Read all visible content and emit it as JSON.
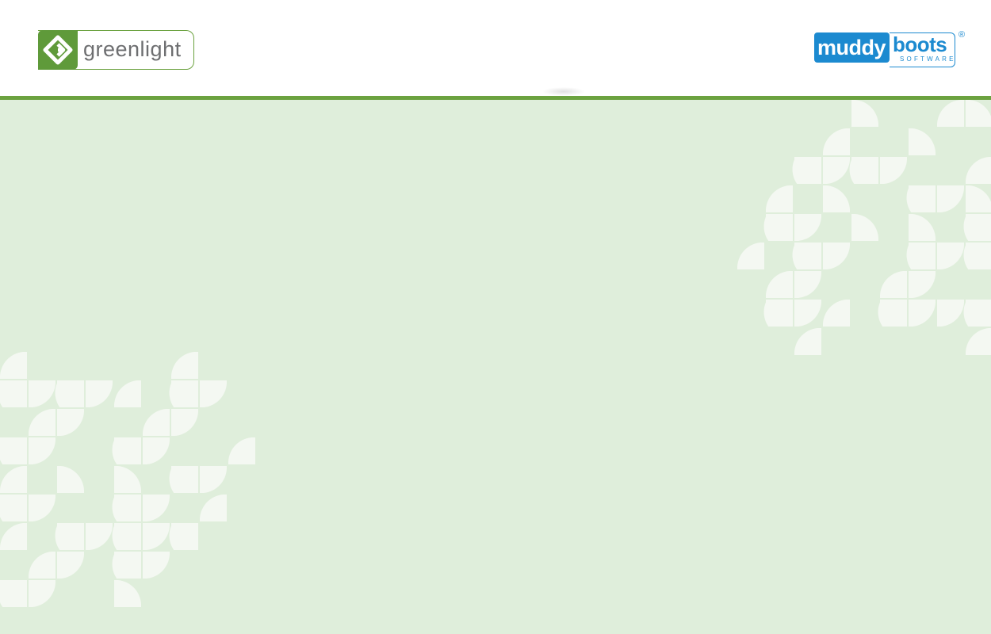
{
  "header": {
    "left_logo": {
      "text": "greenlight",
      "icon": "greenlight-g-icon",
      "color": "#5f9a3a"
    },
    "right_logo": {
      "word1": "muddy",
      "word2": "boots",
      "tagline": "SOFTWARE",
      "registered": "®",
      "color": "#1c8ad0"
    },
    "rule_color": "#6ba23f"
  },
  "main": {
    "background_color": "#dfeedb",
    "pattern": "leaf-pattern",
    "pattern_color": "#f4f8f2"
  }
}
